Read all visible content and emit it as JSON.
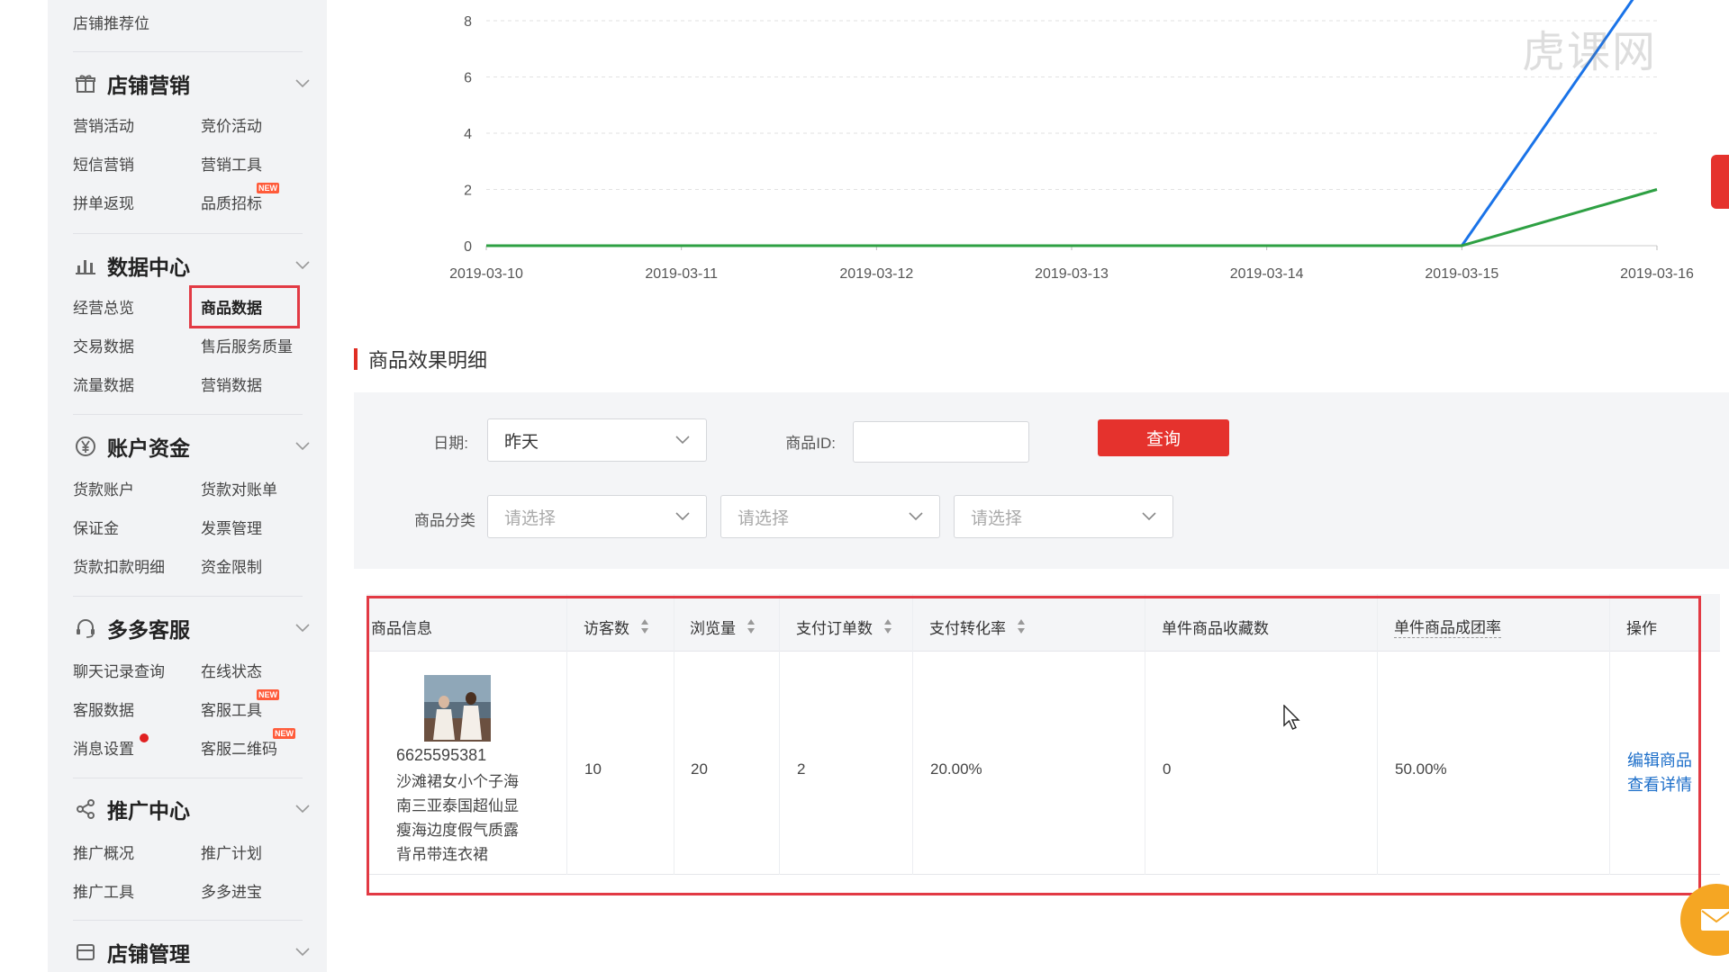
{
  "sidebar": {
    "top_link": "店铺推荐位",
    "sections": [
      {
        "title": "店铺营销",
        "icon": "gift-icon",
        "items": [
          "营销活动",
          "竞价活动",
          "短信营销",
          "营销工具",
          "拼单返现",
          "品质招标"
        ]
      },
      {
        "title": "数据中心",
        "icon": "bar-chart-icon",
        "items": [
          "经营总览",
          "商品数据",
          "交易数据",
          "售后服务质量",
          "流量数据",
          "营销数据"
        ]
      },
      {
        "title": "账户资金",
        "icon": "yen-icon",
        "items": [
          "货款账户",
          "货款对账单",
          "保证金",
          "发票管理",
          "货款扣款明细",
          "资金限制"
        ]
      },
      {
        "title": "多多客服",
        "icon": "headset-icon",
        "items": [
          "聊天记录查询",
          "在线状态",
          "客服数据",
          "客服工具",
          "消息设置",
          "客服二维码"
        ]
      },
      {
        "title": "推广中心",
        "icon": "share-icon",
        "items": [
          "推广概况",
          "推广计划",
          "推广工具",
          "多多进宝"
        ]
      },
      {
        "title": "店铺管理",
        "icon": "store-icon",
        "items": []
      }
    ],
    "new_badge": "NEW",
    "active_item": "商品数据"
  },
  "chart_data": {
    "type": "line",
    "x": [
      "2019-03-10",
      "2019-03-11",
      "2019-03-12",
      "2019-03-13",
      "2019-03-14",
      "2019-03-15",
      "2019-03-16"
    ],
    "y_ticks": [
      0,
      2,
      4,
      6,
      8
    ],
    "ylim": [
      0,
      8
    ],
    "series": [
      {
        "values": [
          0,
          0,
          0,
          0,
          0,
          0,
          10
        ],
        "color": "#1a73e8"
      },
      {
        "values": [
          0,
          0,
          0,
          0,
          0,
          0,
          2
        ],
        "color": "#2ea043"
      }
    ],
    "grid": true
  },
  "section": {
    "title": "商品效果明细"
  },
  "filters": {
    "date_label": "日期:",
    "date_value": "昨天",
    "product_id_label": "商品ID:",
    "product_id_value": "",
    "query_button": "查询",
    "category_label": "商品分类",
    "category_placeholders": [
      "请选择",
      "请选择",
      "请选择"
    ]
  },
  "table": {
    "headers": [
      "商品信息",
      "访客数",
      "浏览量",
      "支付订单数",
      "支付转化率",
      "单件商品收藏数",
      "单件商品成团率",
      "操作"
    ],
    "rows": [
      {
        "product_id": "6625595381",
        "product_name": "沙滩裙女小个子海南三亚泰国超仙显瘦海边度假气质露背吊带连衣裙",
        "visitors": "10",
        "views": "20",
        "orders": "2",
        "conversion": "20.00%",
        "favorites": "0",
        "group_rate": "50.00%",
        "actions": [
          "编辑商品",
          "查看详情"
        ]
      }
    ]
  },
  "watermark": "虎课网"
}
